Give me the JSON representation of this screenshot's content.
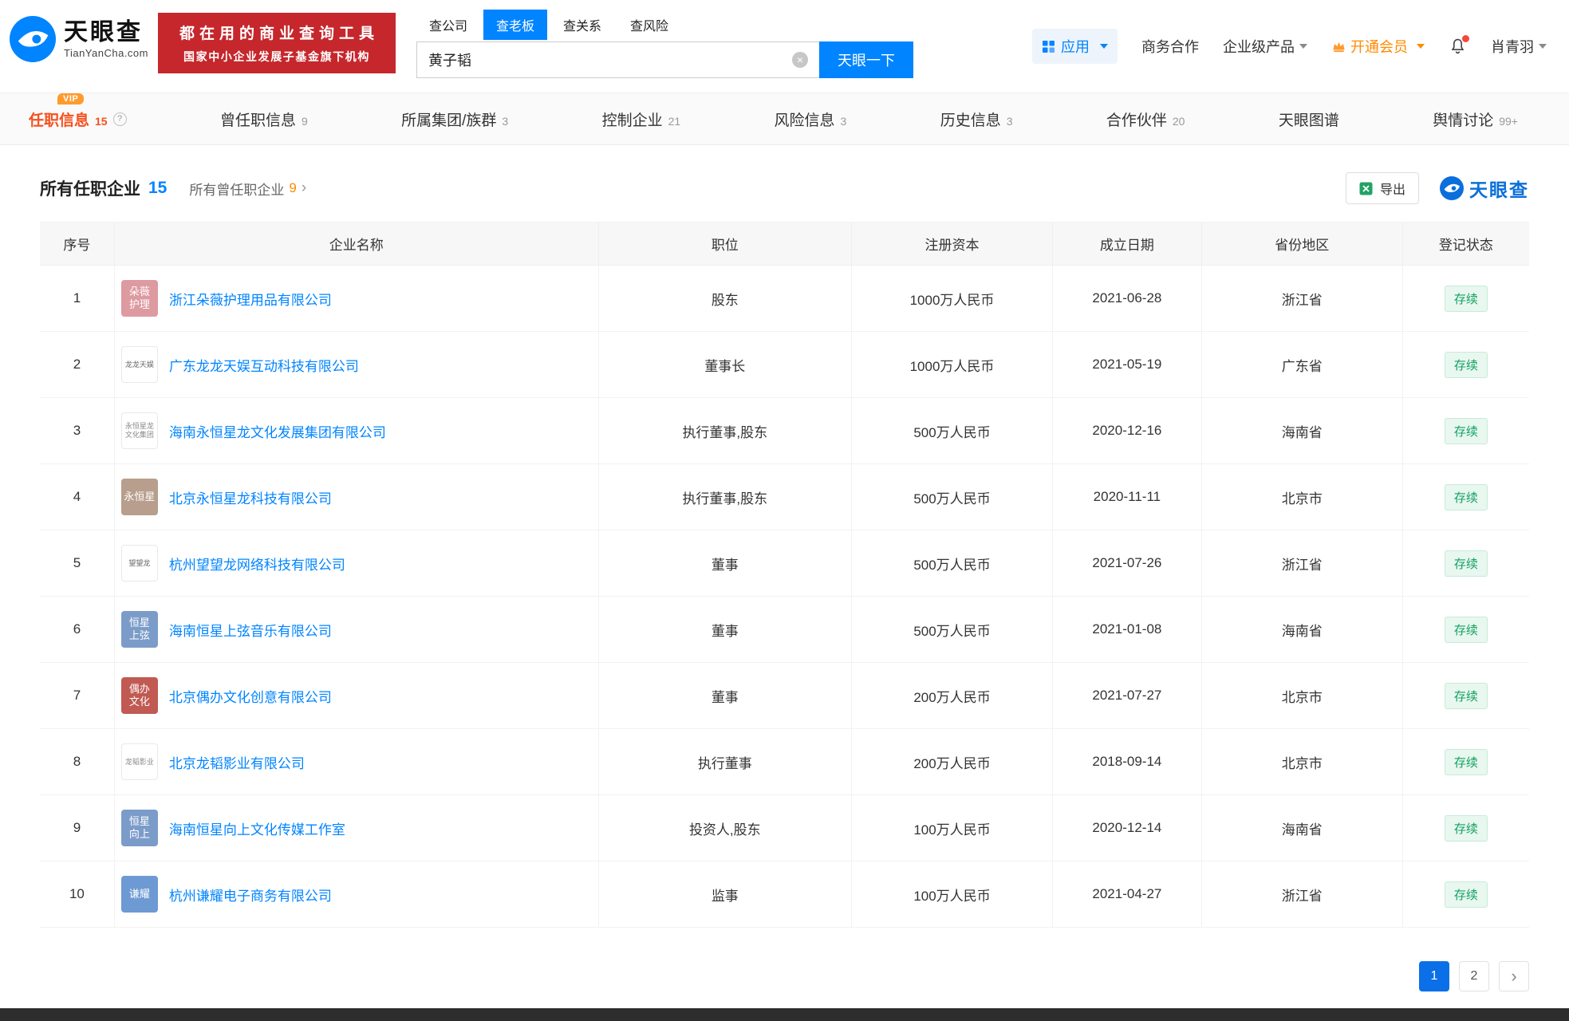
{
  "header": {
    "logo": {
      "brand": "天眼查",
      "domain": "TianYanCha.com"
    },
    "banner": {
      "line1": "都在用的商业查询工具",
      "line2": "国家中小企业发展子基金旗下机构"
    },
    "search": {
      "tabs": [
        {
          "label": "查公司",
          "active": false
        },
        {
          "label": "查老板",
          "active": true
        },
        {
          "label": "查关系",
          "active": false
        },
        {
          "label": "查风险",
          "active": false
        }
      ],
      "value": "黄子韬",
      "button": "天眼一下"
    },
    "menu": {
      "apps": "应用",
      "cooperation": "商务合作",
      "enterprise": "企业级产品",
      "vip": "开通会员",
      "username": "肖青羽"
    }
  },
  "icons": {
    "clear": "×"
  },
  "nav": {
    "vip_badge": "VIP",
    "help_glyph": "?",
    "tabs": [
      {
        "label": "任职信息",
        "count": "15",
        "active": true,
        "vip": true,
        "help": true
      },
      {
        "label": "曾任职信息",
        "count": "9"
      },
      {
        "label": "所属集团/族群",
        "count": "3"
      },
      {
        "label": "控制企业",
        "count": "21"
      },
      {
        "label": "风险信息",
        "count": "3"
      },
      {
        "label": "历史信息",
        "count": "3"
      },
      {
        "label": "合作伙伴",
        "count": "20"
      },
      {
        "label": "天眼图谱",
        "count": ""
      },
      {
        "label": "舆情讨论",
        "count": "99+"
      }
    ]
  },
  "content": {
    "title": "所有任职企业",
    "title_count": "15",
    "subtitle": "所有曾任职企业",
    "subtitle_count": "9",
    "subtitle_arrow": "›",
    "export_label": "导出",
    "watermark": "天眼查"
  },
  "table": {
    "headers": [
      "序号",
      "企业名称",
      "职位",
      "注册资本",
      "成立日期",
      "省份地区",
      "登记状态"
    ],
    "rows": [
      {
        "no": "1",
        "logo": {
          "lines": [
            "朵薇",
            "护理"
          ],
          "bg": "#dd9aa1",
          "fg": "#ffffff"
        },
        "name": "浙江朵薇护理用品有限公司",
        "position": "股东",
        "capital": "1000万人民币",
        "date": "2021-06-28",
        "region": "浙江省",
        "status": "存续"
      },
      {
        "no": "2",
        "logo": {
          "lines": [
            "龙龙天娱"
          ],
          "bg": "#ffffff",
          "fg": "#666666",
          "border": true,
          "size": "xs"
        },
        "name": "广东龙龙天娱互动科技有限公司",
        "position": "董事长",
        "capital": "1000万人民币",
        "date": "2021-05-19",
        "region": "广东省",
        "status": "存续"
      },
      {
        "no": "3",
        "logo": {
          "lines": [
            "永恒星龙",
            "文化集团"
          ],
          "bg": "#ffffff",
          "fg": "#888888",
          "border": true,
          "size": "xs"
        },
        "name": "海南永恒星龙文化发展集团有限公司",
        "position": "执行董事,股东",
        "capital": "500万人民币",
        "date": "2020-12-16",
        "region": "海南省",
        "status": "存续"
      },
      {
        "no": "4",
        "logo": {
          "lines": [
            "永恒星"
          ],
          "bg": "#b79e8d",
          "fg": "#ffffff"
        },
        "name": "北京永恒星龙科技有限公司",
        "position": "执行董事,股东",
        "capital": "500万人民币",
        "date": "2020-11-11",
        "region": "北京市",
        "status": "存续"
      },
      {
        "no": "5",
        "logo": {
          "lines": [
            "望望龙"
          ],
          "bg": "#ffffff",
          "fg": "#666666",
          "border": true,
          "size": "xs"
        },
        "name": "杭州望望龙网络科技有限公司",
        "position": "董事",
        "capital": "500万人民币",
        "date": "2021-07-26",
        "region": "浙江省",
        "status": "存续"
      },
      {
        "no": "6",
        "logo": {
          "lines": [
            "恒星",
            "上弦"
          ],
          "bg": "#7b9cc9",
          "fg": "#ffffff"
        },
        "name": "海南恒星上弦音乐有限公司",
        "position": "董事",
        "capital": "500万人民币",
        "date": "2021-01-08",
        "region": "海南省",
        "status": "存续"
      },
      {
        "no": "7",
        "logo": {
          "lines": [
            "偶办",
            "文化"
          ],
          "bg": "#c05a52",
          "fg": "#ffffff"
        },
        "name": "北京偶办文化创意有限公司",
        "position": "董事",
        "capital": "200万人民币",
        "date": "2021-07-27",
        "region": "北京市",
        "status": "存续"
      },
      {
        "no": "8",
        "logo": {
          "lines": [
            "龙韬影业"
          ],
          "bg": "#ffffff",
          "fg": "#888888",
          "border": true,
          "size": "xs"
        },
        "name": "北京龙韬影业有限公司",
        "position": "执行董事",
        "capital": "200万人民币",
        "date": "2018-09-14",
        "region": "北京市",
        "status": "存续"
      },
      {
        "no": "9",
        "logo": {
          "lines": [
            "恒星",
            "向上"
          ],
          "bg": "#7b9cc9",
          "fg": "#ffffff"
        },
        "name": "海南恒星向上文化传媒工作室",
        "position": "投资人,股东",
        "capital": "100万人民币",
        "date": "2020-12-14",
        "region": "海南省",
        "status": "存续"
      },
      {
        "no": "10",
        "logo": {
          "lines": [
            "谦耀"
          ],
          "bg": "#6d9ad2",
          "fg": "#ffffff"
        },
        "name": "杭州谦耀电子商务有限公司",
        "position": "监事",
        "capital": "100万人民币",
        "date": "2021-04-27",
        "region": "浙江省",
        "status": "存续"
      }
    ]
  },
  "pagination": {
    "pages": [
      "1",
      "2"
    ],
    "current": "1",
    "next": "›"
  }
}
